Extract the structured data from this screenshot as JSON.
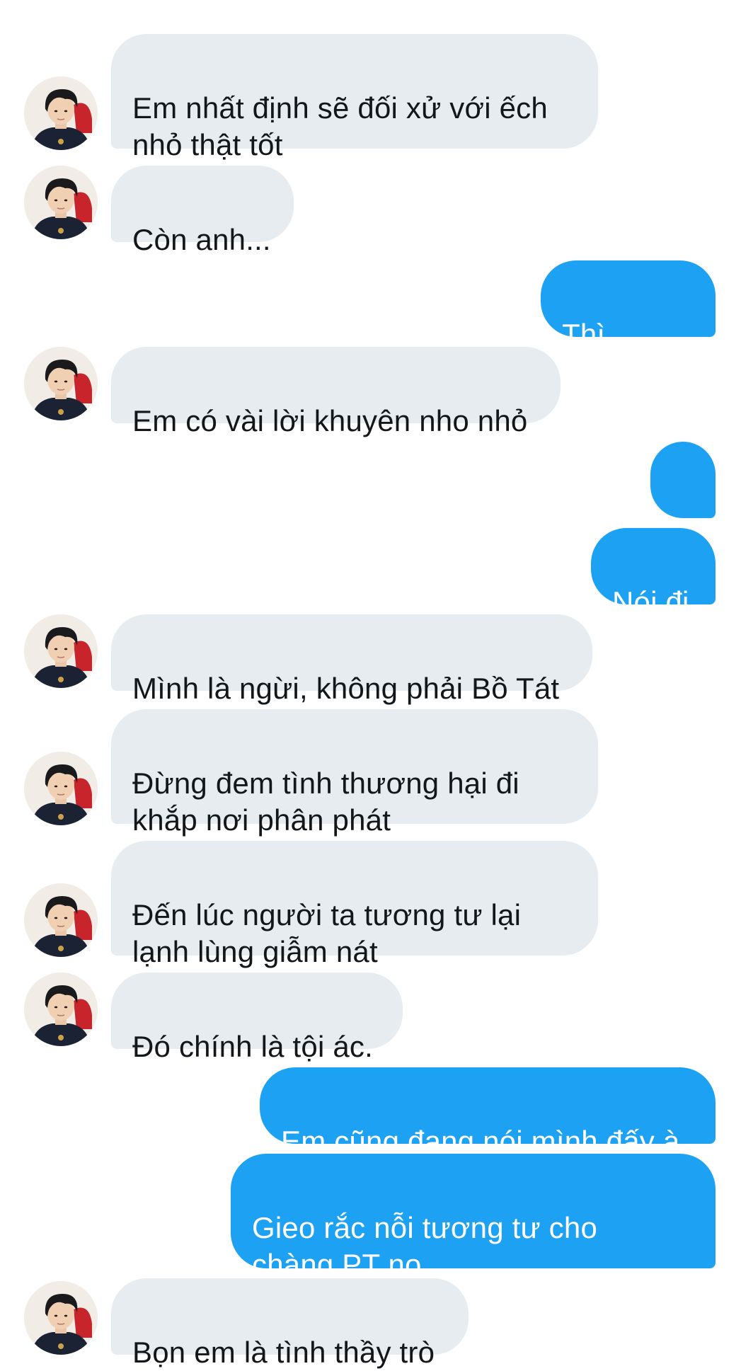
{
  "conversation": {
    "messages": [
      {
        "sender": "them",
        "text": "Em nhất định sẽ đối xử với ếch\nnhỏ thật tốt"
      },
      {
        "sender": "them",
        "text": "Còn anh..."
      },
      {
        "sender": "me",
        "text": "Thì sao??"
      },
      {
        "sender": "them",
        "text": "Em có vài lời khuyên nho nhỏ"
      },
      {
        "sender": "me",
        "text": "..."
      },
      {
        "sender": "me",
        "text": "Nói đi"
      },
      {
        "sender": "them",
        "text": "Mình là ngừi, không phải Bồ Tát"
      },
      {
        "sender": "them",
        "text": "Đừng đem tình thương hại đi\nkhắp nơi phân phát"
      },
      {
        "sender": "them",
        "text": "Đến lúc người ta tương tư lại\nlạnh lùng giẫm nát"
      },
      {
        "sender": "them",
        "text": "Đó chính là tội ác."
      },
      {
        "sender": "me",
        "text": "Em cũng đang nói mình đấy à"
      },
      {
        "sender": "me",
        "text": "Gieo rắc nỗi tương tư cho\nchàng PT nọ"
      },
      {
        "sender": "them",
        "text": "Bọn em là tình thầy trò"
      }
    ]
  },
  "colors": {
    "incoming_bubble": "#e6ecf0",
    "incoming_text": "#14171a",
    "outgoing_bubble": "#1da1f2",
    "outgoing_text": "#ffffff",
    "background": "#ffffff"
  },
  "icons": {
    "avatar": "contact-avatar-photo"
  }
}
